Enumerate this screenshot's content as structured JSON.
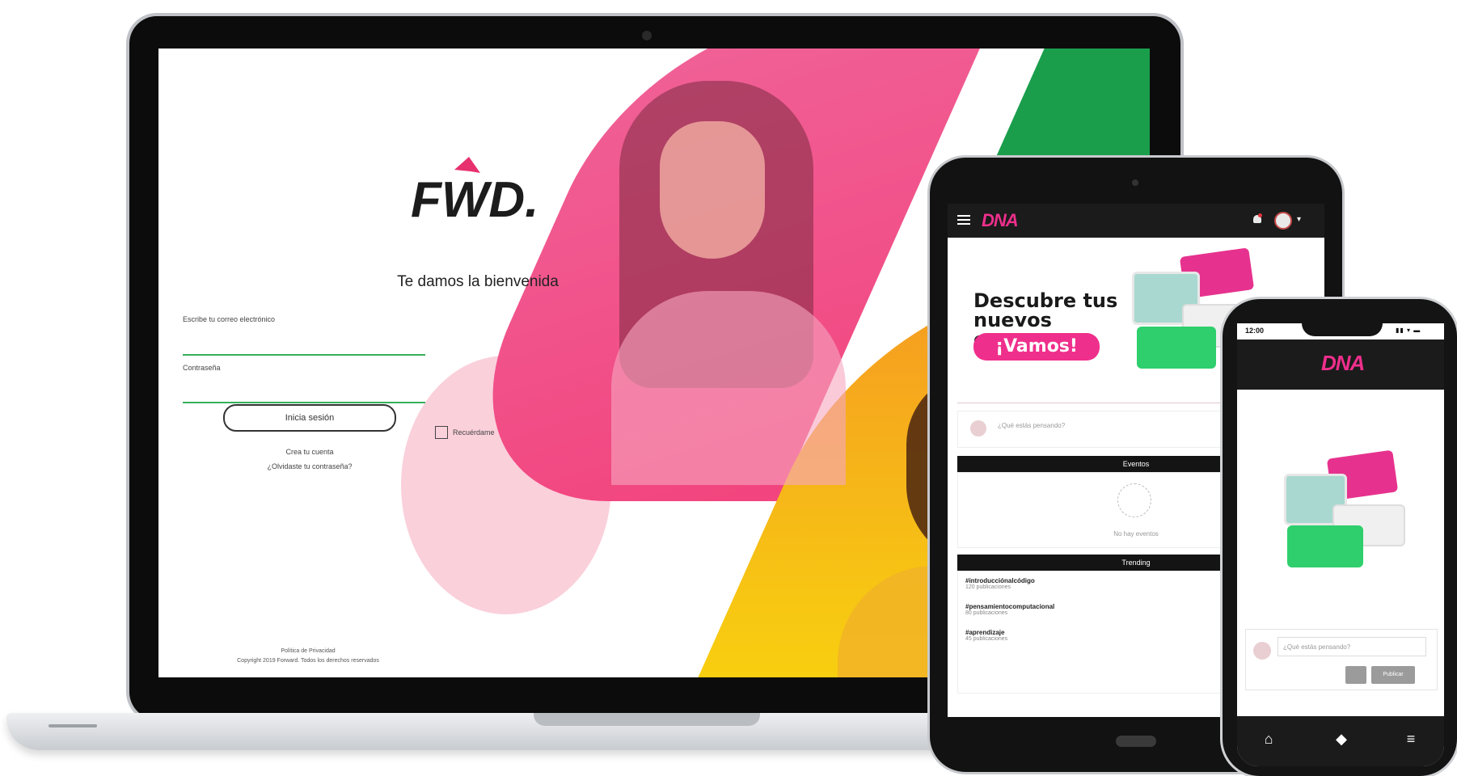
{
  "laptop": {
    "logo_text": "FWD.",
    "welcome": "Te damos la bienvenida",
    "email_label": "Escribe tu correo electrónico",
    "password_label": "Contraseña",
    "remember_label": "Recuérdame",
    "login_button": "Inicia sesión",
    "create_account": "Crea tu cuenta",
    "forgot_password": "¿Olvidaste tu contraseña?",
    "privacy": "Política de Privacidad",
    "copyright": "Copyright 2019 Forward. Todos los derechos reservados"
  },
  "tablet": {
    "brand": "DNA",
    "hero_title": "Descubre tus nuevos cursos",
    "hero_button": "¡Vamos!",
    "post_placeholder": "¿Qué estás pensando?",
    "section_events": "Eventos",
    "events_empty": "No hay eventos",
    "section_trending": "Trending",
    "trending": [
      {
        "title": "#introducciónalcódigo",
        "sub": "120 publicaciones"
      },
      {
        "title": "#pensamientocomputacional",
        "sub": "80 publicaciones"
      },
      {
        "title": "#aprendizaje",
        "sub": "45 publicaciones"
      }
    ]
  },
  "phone": {
    "time": "12:00",
    "status_icons": "▮▮ ▾ ▬",
    "brand": "DNA",
    "post_placeholder": "¿Qué estás pensando?",
    "publish_button": "Publicar"
  },
  "colors": {
    "pink": "#ef2f8c",
    "green": "#35b05a",
    "orange": "#f59a22",
    "yellow": "#f7c613",
    "dark": "#1b1b1b"
  }
}
